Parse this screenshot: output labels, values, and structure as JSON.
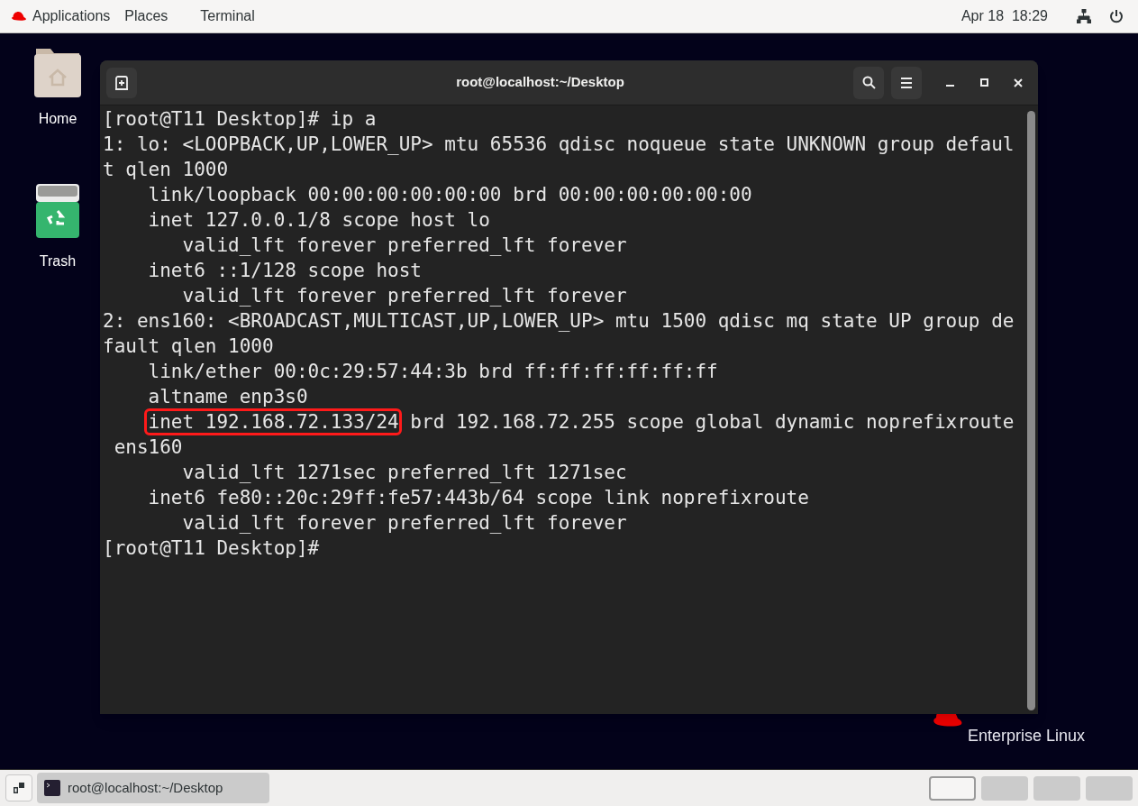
{
  "top_bar": {
    "menus": [
      "Applications",
      "Places",
      "Terminal"
    ],
    "clock": "Apr 18  18:29"
  },
  "desktop_icons": [
    {
      "label": "Home",
      "kind": "folder"
    },
    {
      "label": "Trash",
      "kind": "trash"
    }
  ],
  "branding": {
    "line_2": "Enterprise Linux"
  },
  "terminal": {
    "title": "root@localhost:~/Desktop",
    "lines": [
      {
        "kind": "plain",
        "text": "[root@T11 Desktop]# ip a"
      },
      {
        "kind": "plain",
        "text": "1: lo: <LOOPBACK,UP,LOWER_UP> mtu 65536 qdisc noqueue state UNKNOWN group defaul"
      },
      {
        "kind": "plain",
        "text": "t qlen 1000"
      },
      {
        "kind": "plain",
        "text": "    link/loopback 00:00:00:00:00:00 brd 00:00:00:00:00:00"
      },
      {
        "kind": "plain",
        "text": "    inet 127.0.0.1/8 scope host lo"
      },
      {
        "kind": "plain",
        "text": "       valid_lft forever preferred_lft forever"
      },
      {
        "kind": "plain",
        "text": "    inet6 ::1/128 scope host"
      },
      {
        "kind": "plain",
        "text": "       valid_lft forever preferred_lft forever"
      },
      {
        "kind": "plain",
        "text": "2: ens160: <BROADCAST,MULTICAST,UP,LOWER_UP> mtu 1500 qdisc mq state UP group de"
      },
      {
        "kind": "plain",
        "text": "fault qlen 1000"
      },
      {
        "kind": "plain",
        "text": "    link/ether 00:0c:29:57:44:3b brd ff:ff:ff:ff:ff:ff"
      },
      {
        "kind": "plain",
        "text": "    altname enp3s0"
      },
      {
        "kind": "marked",
        "marked": "inet 192.168.72.133/24",
        "after": " brd 192.168.72.255 scope global dynamic noprefixroute"
      },
      {
        "kind": "plain",
        "text": " ens160"
      },
      {
        "kind": "plain",
        "text": "       valid_lft 1271sec preferred_lft 1271sec"
      },
      {
        "kind": "plain",
        "text": "    inet6 fe80::20c:29ff:fe57:443b/64 scope link noprefixroute"
      },
      {
        "kind": "plain",
        "text": "       valid_lft forever preferred_lft forever"
      },
      {
        "kind": "plain",
        "text": "[root@T11 Desktop]#"
      }
    ]
  },
  "taskbar": {
    "windows": [
      {
        "label": "root@localhost:~/Desktop"
      }
    ],
    "workspaces": [
      {
        "selected": true
      },
      {
        "selected": false
      },
      {
        "selected": false
      },
      {
        "selected": false
      }
    ]
  }
}
